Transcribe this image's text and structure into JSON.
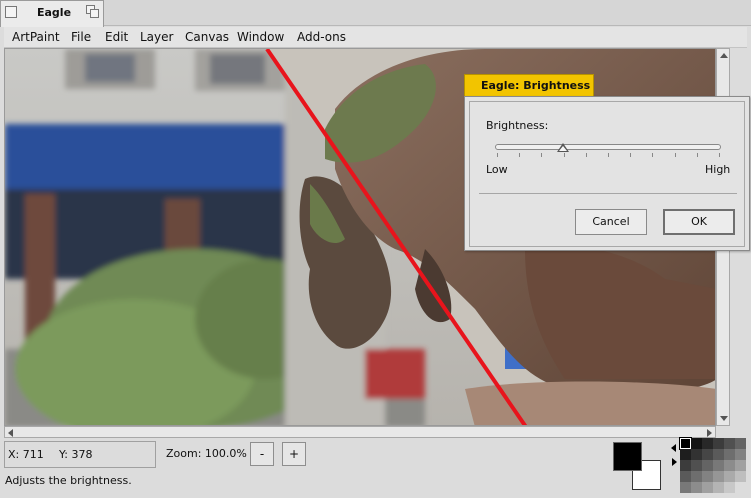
{
  "window": {
    "title": "Eagle"
  },
  "menu": [
    "ArtPaint",
    "File",
    "Edit",
    "Layer",
    "Canvas",
    "Window",
    "Add-ons"
  ],
  "status": {
    "x_label": "X: 711",
    "y_label": "Y: 378",
    "zoom": "Zoom: 100.0%",
    "zoom_out": "-",
    "zoom_in": "+",
    "message": "Adjusts the brightness."
  },
  "colors": {
    "foreground": "#000000",
    "background": "#ffffff",
    "divider_line": "#e8141c",
    "dialog_tab": "#f2c400"
  },
  "dialog": {
    "title": "Eagle: Brightness",
    "field_label": "Brightness:",
    "low": "Low",
    "high": "High",
    "slider_value": 0.3,
    "cancel": "Cancel",
    "ok": "OK"
  }
}
